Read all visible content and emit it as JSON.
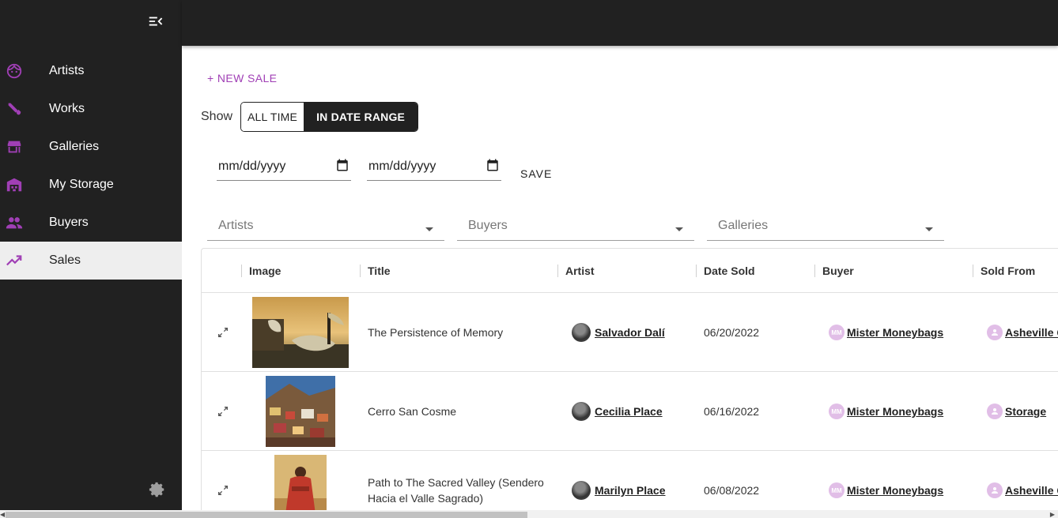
{
  "sidebar": {
    "items": [
      {
        "label": "Artists",
        "icon": "face-icon",
        "active": false
      },
      {
        "label": "Works",
        "icon": "brush-icon",
        "active": false
      },
      {
        "label": "Galleries",
        "icon": "store-icon",
        "active": false
      },
      {
        "label": "My Storage",
        "icon": "warehouse-icon",
        "active": false
      },
      {
        "label": "Buyers",
        "icon": "people-icon",
        "active": false
      },
      {
        "label": "Sales",
        "icon": "trending-up-icon",
        "active": true
      }
    ],
    "accent": "#a03fb5"
  },
  "toolbar": {
    "new_sale_label": "+ NEW SALE",
    "show_label": "Show",
    "toggle": {
      "all_time": "ALL TIME",
      "in_date_range": "IN DATE RANGE",
      "selected": "IN DATE RANGE"
    },
    "date_from_placeholder": "mm/dd/yyyy",
    "date_to_placeholder": "mm/dd/yyyy",
    "save_label": "SAVE"
  },
  "filters": {
    "artists_placeholder": "Artists",
    "buyers_placeholder": "Buyers",
    "galleries_placeholder": "Galleries"
  },
  "table": {
    "columns": {
      "image": "Image",
      "title": "Title",
      "artist": "Artist",
      "date_sold": "Date Sold",
      "buyer": "Buyer",
      "sold_from": "Sold From"
    },
    "rows": [
      {
        "title": "The Persistence of Memory",
        "artist": "Salvador Dalí",
        "date_sold": "06/20/2022",
        "buyer_initials": "MM",
        "buyer": "Mister Moneybags",
        "sold_from": "Asheville G"
      },
      {
        "title": "Cerro San Cosme",
        "artist": "Cecilia Place",
        "date_sold": "06/16/2022",
        "buyer_initials": "MM",
        "buyer": "Mister Moneybags",
        "sold_from": "Storage"
      },
      {
        "title": "Path to The Sacred Valley (Sendero Hacia el Valle Sagrado)",
        "artist": "Marilyn Place",
        "date_sold": "06/08/2022",
        "buyer_initials": "MM",
        "buyer": "Mister Moneybags",
        "sold_from": "Asheville G"
      }
    ]
  }
}
